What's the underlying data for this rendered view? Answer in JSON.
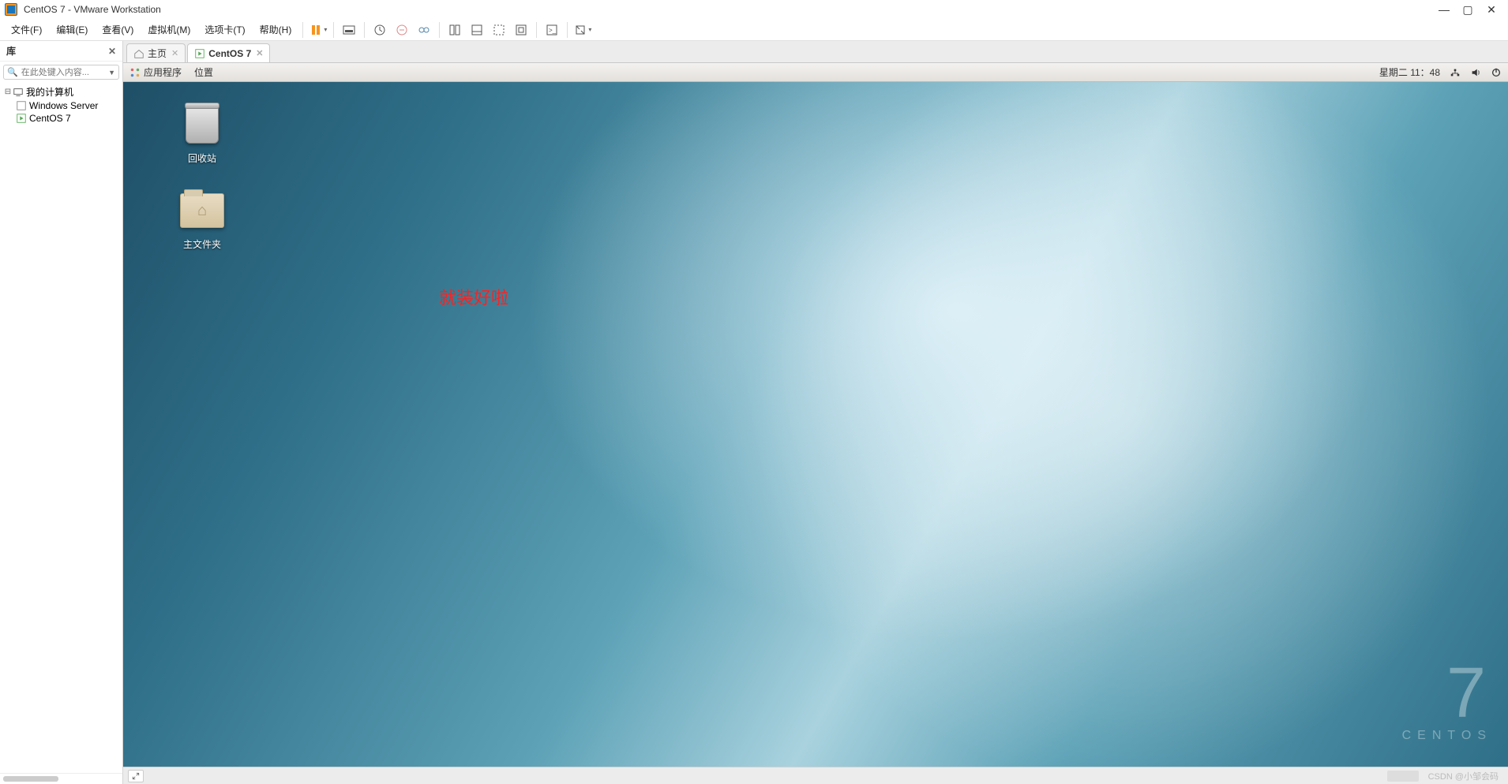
{
  "titlebar": {
    "title": "CentOS 7  - VMware Workstation"
  },
  "menu": {
    "file": "文件(F)",
    "edit": "编辑(E)",
    "view": "查看(V)",
    "vm": "虚拟机(M)",
    "tabs": "选项卡(T)",
    "help": "帮助(H)"
  },
  "sidebar": {
    "title": "库",
    "search_placeholder": "在此处键入内容...",
    "tree": {
      "root": "我的计算机",
      "items": [
        "Windows Server",
        "CentOS 7"
      ]
    }
  },
  "tabs": {
    "home": "主页",
    "active": "CentOS 7"
  },
  "gnome": {
    "apps": "应用程序",
    "places": "位置",
    "clock": "星期二 11：48"
  },
  "desktop": {
    "trash": "回收站",
    "home": "主文件夹",
    "annotation": "就装好啦"
  },
  "brand": {
    "num": "7",
    "name": "CENTOS"
  },
  "watermark": "CSDN @小邹会码"
}
